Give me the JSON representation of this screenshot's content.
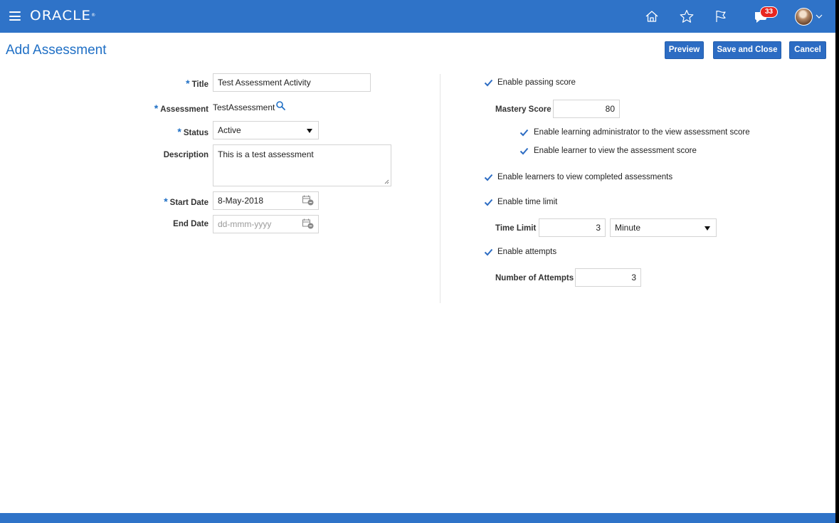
{
  "header": {
    "logo": "ORACLE",
    "notification_count": "33",
    "icons": [
      "menu-icon",
      "home-icon",
      "star-icon",
      "flag-icon",
      "notifications-icon",
      "user-avatar",
      "chevron-down-icon"
    ]
  },
  "page": {
    "title": "Add Assessment",
    "buttons": {
      "preview": "Preview",
      "save_close": "Save and Close",
      "cancel": "Cancel"
    }
  },
  "form": {
    "title": {
      "label": "Title",
      "value": "Test Assessment Activity",
      "required": true
    },
    "assessment": {
      "label": "Assessment",
      "value": "TestAssessment",
      "required": true
    },
    "status": {
      "label": "Status",
      "value": "Active",
      "required": true
    },
    "description": {
      "label": "Description",
      "value": "This is a test assessment"
    },
    "start_date": {
      "label": "Start Date",
      "value": "8-May-2018",
      "required": true
    },
    "end_date": {
      "label": "End Date",
      "placeholder": "dd-mmm-yyyy"
    }
  },
  "options": {
    "passing_score": {
      "label": "Enable passing score",
      "checked": true
    },
    "mastery_score": {
      "label": "Mastery Score",
      "value": "80"
    },
    "admin_view": {
      "label": "Enable learning administrator to the view assessment score",
      "checked": true
    },
    "learner_view": {
      "label": "Enable learner to view the assessment score",
      "checked": true
    },
    "completed_view": {
      "label": "Enable learners to view completed assessments",
      "checked": true
    },
    "time_limit_enable": {
      "label": "Enable time limit",
      "checked": true
    },
    "time_limit": {
      "label": "Time Limit",
      "value": "3",
      "unit": "Minute"
    },
    "attempts_enable": {
      "label": "Enable attempts",
      "checked": true
    },
    "attempts": {
      "label": "Number of Attempts",
      "value": "3"
    }
  },
  "colors": {
    "brand_blue": "#2f73c8",
    "title_blue": "#1f6fc5",
    "button_blue": "#2c6cc3",
    "badge_red": "#e8261f"
  }
}
